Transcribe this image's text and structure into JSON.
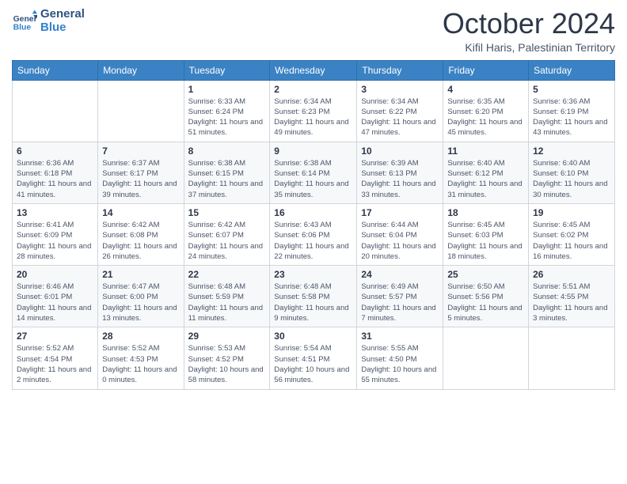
{
  "logo": {
    "line1": "General",
    "line2": "Blue"
  },
  "title": "October 2024",
  "location": "Kifil Haris, Palestinian Territory",
  "headers": [
    "Sunday",
    "Monday",
    "Tuesday",
    "Wednesday",
    "Thursday",
    "Friday",
    "Saturday"
  ],
  "weeks": [
    [
      {
        "day": "",
        "info": ""
      },
      {
        "day": "",
        "info": ""
      },
      {
        "day": "1",
        "info": "Sunrise: 6:33 AM\nSunset: 6:24 PM\nDaylight: 11 hours and 51 minutes."
      },
      {
        "day": "2",
        "info": "Sunrise: 6:34 AM\nSunset: 6:23 PM\nDaylight: 11 hours and 49 minutes."
      },
      {
        "day": "3",
        "info": "Sunrise: 6:34 AM\nSunset: 6:22 PM\nDaylight: 11 hours and 47 minutes."
      },
      {
        "day": "4",
        "info": "Sunrise: 6:35 AM\nSunset: 6:20 PM\nDaylight: 11 hours and 45 minutes."
      },
      {
        "day": "5",
        "info": "Sunrise: 6:36 AM\nSunset: 6:19 PM\nDaylight: 11 hours and 43 minutes."
      }
    ],
    [
      {
        "day": "6",
        "info": "Sunrise: 6:36 AM\nSunset: 6:18 PM\nDaylight: 11 hours and 41 minutes."
      },
      {
        "day": "7",
        "info": "Sunrise: 6:37 AM\nSunset: 6:17 PM\nDaylight: 11 hours and 39 minutes."
      },
      {
        "day": "8",
        "info": "Sunrise: 6:38 AM\nSunset: 6:15 PM\nDaylight: 11 hours and 37 minutes."
      },
      {
        "day": "9",
        "info": "Sunrise: 6:38 AM\nSunset: 6:14 PM\nDaylight: 11 hours and 35 minutes."
      },
      {
        "day": "10",
        "info": "Sunrise: 6:39 AM\nSunset: 6:13 PM\nDaylight: 11 hours and 33 minutes."
      },
      {
        "day": "11",
        "info": "Sunrise: 6:40 AM\nSunset: 6:12 PM\nDaylight: 11 hours and 31 minutes."
      },
      {
        "day": "12",
        "info": "Sunrise: 6:40 AM\nSunset: 6:10 PM\nDaylight: 11 hours and 30 minutes."
      }
    ],
    [
      {
        "day": "13",
        "info": "Sunrise: 6:41 AM\nSunset: 6:09 PM\nDaylight: 11 hours and 28 minutes."
      },
      {
        "day": "14",
        "info": "Sunrise: 6:42 AM\nSunset: 6:08 PM\nDaylight: 11 hours and 26 minutes."
      },
      {
        "day": "15",
        "info": "Sunrise: 6:42 AM\nSunset: 6:07 PM\nDaylight: 11 hours and 24 minutes."
      },
      {
        "day": "16",
        "info": "Sunrise: 6:43 AM\nSunset: 6:06 PM\nDaylight: 11 hours and 22 minutes."
      },
      {
        "day": "17",
        "info": "Sunrise: 6:44 AM\nSunset: 6:04 PM\nDaylight: 11 hours and 20 minutes."
      },
      {
        "day": "18",
        "info": "Sunrise: 6:45 AM\nSunset: 6:03 PM\nDaylight: 11 hours and 18 minutes."
      },
      {
        "day": "19",
        "info": "Sunrise: 6:45 AM\nSunset: 6:02 PM\nDaylight: 11 hours and 16 minutes."
      }
    ],
    [
      {
        "day": "20",
        "info": "Sunrise: 6:46 AM\nSunset: 6:01 PM\nDaylight: 11 hours and 14 minutes."
      },
      {
        "day": "21",
        "info": "Sunrise: 6:47 AM\nSunset: 6:00 PM\nDaylight: 11 hours and 13 minutes."
      },
      {
        "day": "22",
        "info": "Sunrise: 6:48 AM\nSunset: 5:59 PM\nDaylight: 11 hours and 11 minutes."
      },
      {
        "day": "23",
        "info": "Sunrise: 6:48 AM\nSunset: 5:58 PM\nDaylight: 11 hours and 9 minutes."
      },
      {
        "day": "24",
        "info": "Sunrise: 6:49 AM\nSunset: 5:57 PM\nDaylight: 11 hours and 7 minutes."
      },
      {
        "day": "25",
        "info": "Sunrise: 6:50 AM\nSunset: 5:56 PM\nDaylight: 11 hours and 5 minutes."
      },
      {
        "day": "26",
        "info": "Sunrise: 5:51 AM\nSunset: 4:55 PM\nDaylight: 11 hours and 3 minutes."
      }
    ],
    [
      {
        "day": "27",
        "info": "Sunrise: 5:52 AM\nSunset: 4:54 PM\nDaylight: 11 hours and 2 minutes."
      },
      {
        "day": "28",
        "info": "Sunrise: 5:52 AM\nSunset: 4:53 PM\nDaylight: 11 hours and 0 minutes."
      },
      {
        "day": "29",
        "info": "Sunrise: 5:53 AM\nSunset: 4:52 PM\nDaylight: 10 hours and 58 minutes."
      },
      {
        "day": "30",
        "info": "Sunrise: 5:54 AM\nSunset: 4:51 PM\nDaylight: 10 hours and 56 minutes."
      },
      {
        "day": "31",
        "info": "Sunrise: 5:55 AM\nSunset: 4:50 PM\nDaylight: 10 hours and 55 minutes."
      },
      {
        "day": "",
        "info": ""
      },
      {
        "day": "",
        "info": ""
      }
    ]
  ]
}
